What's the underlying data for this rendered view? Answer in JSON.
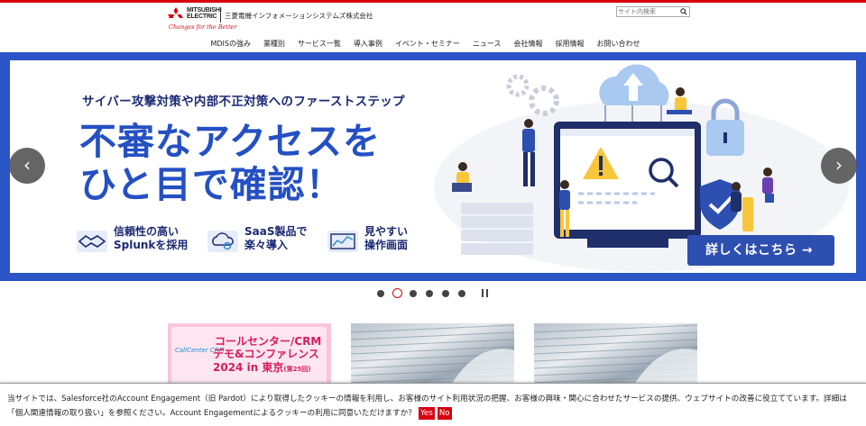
{
  "header": {
    "brand_line1": "MITSUBISHI",
    "brand_line2": "ELECTRIC",
    "corp_name": "三菱電機インフォメーションシステムズ株式会社",
    "tagline": "Changes for the Better",
    "search_placeholder": "サイト内検索"
  },
  "nav": {
    "items": [
      {
        "label": "MDISの強み"
      },
      {
        "label": "業種別"
      },
      {
        "label": "サービス一覧"
      },
      {
        "label": "導入事例"
      },
      {
        "label": "イベント・セミナー"
      },
      {
        "label": "ニュース"
      },
      {
        "label": "会社情報"
      },
      {
        "label": "採用情報"
      },
      {
        "label": "お問い合わせ"
      }
    ]
  },
  "hero": {
    "subtitle": "サイバー攻撃対策や内部不正対策へのファーストステップ",
    "headline_line1": "不審なアクセスを",
    "headline_line2": "ひと目で確認！",
    "features": [
      {
        "line1": "信頼性の高い",
        "line2": "Splunkを採用",
        "icon": "handshake-icon"
      },
      {
        "line1": "SaaS製品で",
        "line2": "楽々導入",
        "icon": "cloud-gear-icon"
      },
      {
        "line1": "見やすい",
        "line2": "操作画面",
        "icon": "chart-screen-icon"
      }
    ],
    "cta_label": "詳しくはこちら →",
    "colors": {
      "frame": "#2b55c6",
      "headline": "#2450c4",
      "cta": "#2d4fb0"
    }
  },
  "carousel": {
    "prev_icon": "‹",
    "next_icon": "›",
    "slide_count": 6,
    "active_index": 1
  },
  "cards": [
    {
      "logo": "CallCenter CRM",
      "title1": "コールセンター/CRM",
      "title2": "デモ&コンファレンス",
      "title3": "2024 in 東京",
      "title3_small": "(第25回)"
    },
    {
      "image": "newspaper"
    },
    {
      "image": "newspaper"
    }
  ],
  "cookie": {
    "text": "当サイトでは、Salesforce社のAccount Engagement（旧 Pardot）により取得したクッキーの情報を利用し、お客様のサイト利用状況の把握、お客様の興味・関心に合わせたサービスの提供、ウェブサイトの改善に役立てています。詳細は「個人関連情報の取り扱い」を参照ください。Account Engagementによるクッキーの利用に同意いただけますか？",
    "yes_label": "Yes",
    "no_label": "No"
  }
}
